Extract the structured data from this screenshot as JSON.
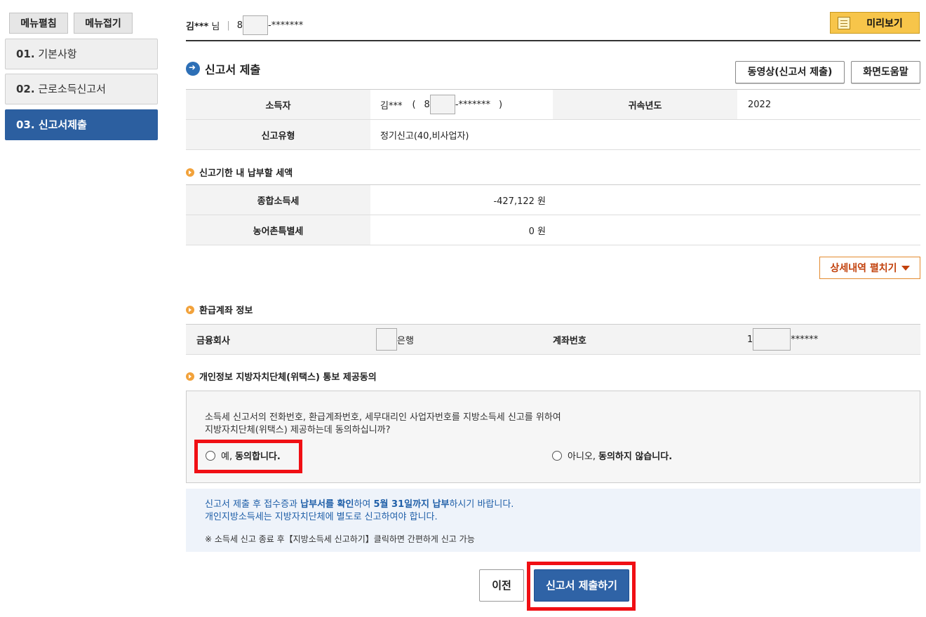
{
  "sidebar": {
    "menu_open_label": "메뉴펼침",
    "menu_close_label": "메뉴접기",
    "items": [
      {
        "num": "01.",
        "label": "기본사항",
        "active": false
      },
      {
        "num": "02.",
        "label": "근로소득신고서",
        "active": false
      },
      {
        "num": "03.",
        "label": "신고서제출",
        "active": true
      }
    ]
  },
  "header": {
    "user_name": "김***",
    "honorific": "님",
    "separator": "|",
    "id_prefix": "8",
    "id_suffix": "-*******",
    "preview_label": "미리보기"
  },
  "submission": {
    "title": "신고서 제출",
    "video_button": "동영상(신고서 제출)",
    "help_button": "화면도움말",
    "rows": {
      "earner_label": "소득자",
      "earner_name": "김***",
      "earner_id_prefix": "8",
      "earner_id_suffix": "-*******",
      "paren_open": "(",
      "paren_close": ")",
      "year_label": "귀속년도",
      "year_value": "2022",
      "type_label": "신고유형",
      "type_value": "정기신고(40,비사업자)"
    }
  },
  "tax_due": {
    "title": "신고기한 내 납부할 세액",
    "income_tax_label": "종합소득세",
    "income_tax_value": "-427,122 원",
    "rural_tax_label": "농어촌특별세",
    "rural_tax_value": "0 원",
    "detail_button": "상세내역 펼치기"
  },
  "refund": {
    "title": "환급계좌 정보",
    "bank_label": "금융회사",
    "bank_suffix": "은행",
    "account_label": "계좌번호",
    "account_prefix": "1",
    "account_suffix": "******"
  },
  "consent": {
    "title": "개인정보 지방자치단체(위택스) 통보 제공동의",
    "question_line1": "소득세 신고서의 전화번호, 환급계좌번호, 세무대리인 사업자번호를 지방소득세 신고를 위하여",
    "question_line2": "지방자치단체(위택스) 제공하는데 동의하십니까?",
    "yes_prefix": "예,",
    "yes_bold": "동의합니다.",
    "no_prefix": "아니오,",
    "no_bold": "동의하지 않습니다."
  },
  "notice": {
    "line1_a": "신고서 제출 후 접수증과 ",
    "line1_b": "납부서를 확인",
    "line1_c": "하여 ",
    "line1_d": "5월 31일까지 납부",
    "line1_e": "하시기 바랍니다.",
    "line2": "개인지방소득세는 지방자치단체에 별도로 신고하여야 합니다.",
    "note": "※ 소득세 신고 종료 후【지방소득세 신고하기】클릭하면 간편하게 신고 가능"
  },
  "footer": {
    "prev_label": "이전",
    "submit_label": "신고서 제출하기"
  },
  "colors": {
    "accent_blue": "#2f63a6",
    "highlight_red": "#f00f14",
    "preview_yellow": "#f7c54a"
  }
}
